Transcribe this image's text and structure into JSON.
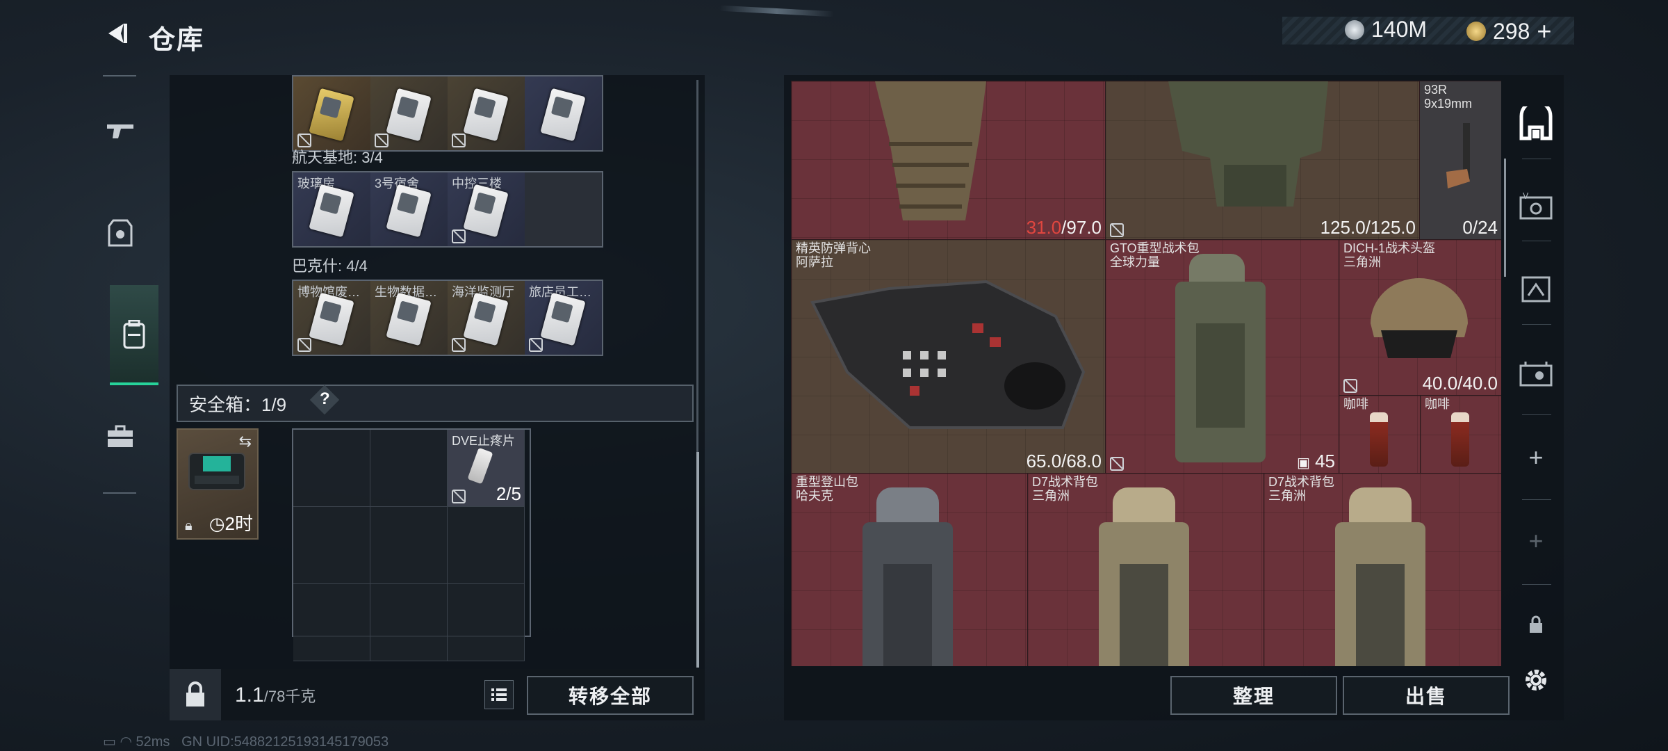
{
  "header": {
    "title": "仓库",
    "currency1": "140M",
    "currency2": "298",
    "currency2_plus": "+"
  },
  "left": {
    "group1": {
      "cells": [
        "",
        "",
        "",
        ""
      ]
    },
    "group2": {
      "label": "航天基地: 3/4",
      "cells": [
        "玻璃房",
        "3号宿舍",
        "中控三楼",
        ""
      ]
    },
    "group3": {
      "label": "巴克什: 4/4",
      "cells": [
        "博物馆废…",
        "生物数据…",
        "海洋监测厅",
        "旅店员工…"
      ]
    },
    "safe_box": {
      "label": "安全箱：1/9",
      "help": "?",
      "timer": "2时"
    },
    "safe_items": [
      {
        "name": "DVE止疼片",
        "count": "2/5"
      }
    ],
    "weight": {
      "current": "1.1",
      "max": "/78千克"
    },
    "transfer_all": "转移全部"
  },
  "right": {
    "items": [
      {
        "id": "armor1",
        "name": "",
        "sub": "",
        "value_red": "31.0",
        "value": "/97.0"
      },
      {
        "id": "armor2",
        "name": "",
        "sub": "",
        "value": "125.0/125.0"
      },
      {
        "id": "pistol",
        "name": "93R",
        "sub": "9x19mm",
        "value": "0/24"
      },
      {
        "id": "vest",
        "name": "精英防弹背心",
        "sub": "阿萨拉",
        "value": "65.0/68.0"
      },
      {
        "id": "gto",
        "name": "GTO重型战术包",
        "sub": "全球力量",
        "value": "45"
      },
      {
        "id": "helmet",
        "name": "DICH-1战术头盔",
        "sub": "三角洲",
        "value": "40.0/40.0"
      },
      {
        "id": "coffee1",
        "name": "咖啡",
        "sub": "",
        "value": ""
      },
      {
        "id": "coffee2",
        "name": "咖啡",
        "sub": "",
        "value": ""
      },
      {
        "id": "bag1",
        "name": "重型登山包",
        "sub": "哈夫克",
        "value": ""
      },
      {
        "id": "bag2",
        "name": "D7战术背包",
        "sub": "三角洲",
        "value": ""
      },
      {
        "id": "bag3",
        "name": "D7战术背包",
        "sub": "三角洲",
        "value": ""
      }
    ],
    "sort": "整理",
    "sell": "出售"
  },
  "status": {
    "ping": "52ms",
    "uid": "GN UID:548821251931451790​53"
  },
  "colors": {
    "accent_green": "#27d39a",
    "red_value": "#e0463f"
  }
}
